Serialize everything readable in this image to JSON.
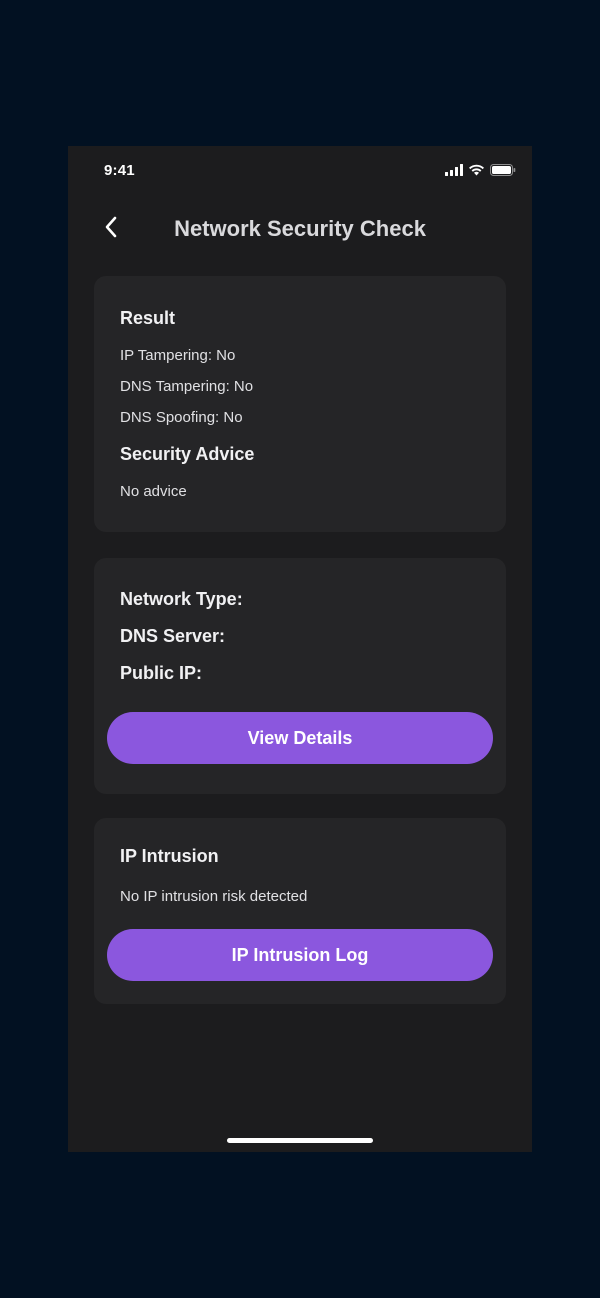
{
  "status_bar": {
    "time": "9:41"
  },
  "nav": {
    "title": "Network Security Check",
    "back_icon": "chevron-left-icon"
  },
  "result_card": {
    "title": "Result",
    "lines": [
      "IP Tampering: No",
      "DNS Tampering: No",
      "DNS Spoofing: No"
    ],
    "advice_title": "Security Advice",
    "advice_text": "No advice"
  },
  "network_card": {
    "labels": [
      "Network Type:",
      "DNS Server:",
      "Public IP:"
    ],
    "button_label": "View Details"
  },
  "intrusion_card": {
    "title": "IP Intrusion",
    "text": "No IP intrusion risk detected",
    "button_label": "IP Intrusion Log"
  },
  "colors": {
    "page_background": "#021122",
    "phone_background": "#1c1c1e",
    "card_background": "#252527",
    "accent": "#8b57de"
  }
}
